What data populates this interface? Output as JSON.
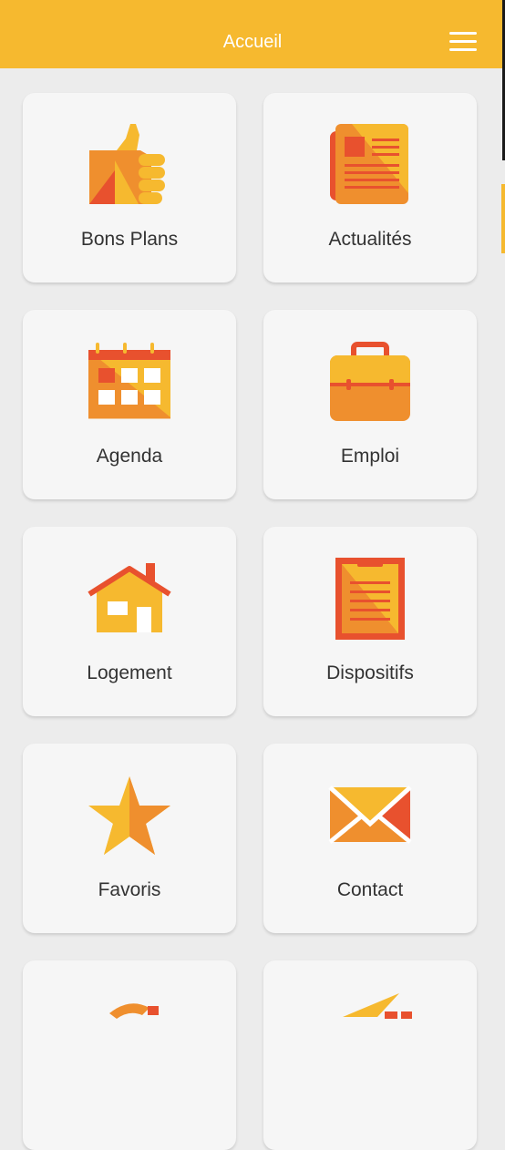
{
  "header": {
    "title": "Accueil",
    "menu_icon": "hamburger-menu-icon"
  },
  "colors": {
    "header_bg": "#f6b92f",
    "page_bg": "#ececec",
    "card_bg": "#f6f6f6",
    "icon_yellow": "#f6b92f",
    "icon_orange": "#ef8f2e",
    "icon_red": "#e8512e",
    "label_text": "#333333"
  },
  "tiles": [
    {
      "label": "Bons Plans",
      "icon": "thumbs-up-icon"
    },
    {
      "label": "Actualités",
      "icon": "newspaper-icon"
    },
    {
      "label": "Agenda",
      "icon": "calendar-icon"
    },
    {
      "label": "Emploi",
      "icon": "briefcase-icon"
    },
    {
      "label": "Logement",
      "icon": "house-icon"
    },
    {
      "label": "Dispositifs",
      "icon": "clipboard-icon"
    },
    {
      "label": "Favoris",
      "icon": "star-icon"
    },
    {
      "label": "Contact",
      "icon": "envelope-icon"
    },
    {
      "label": "",
      "icon": "partial-icon"
    },
    {
      "label": "",
      "icon": "partial-icon"
    }
  ]
}
